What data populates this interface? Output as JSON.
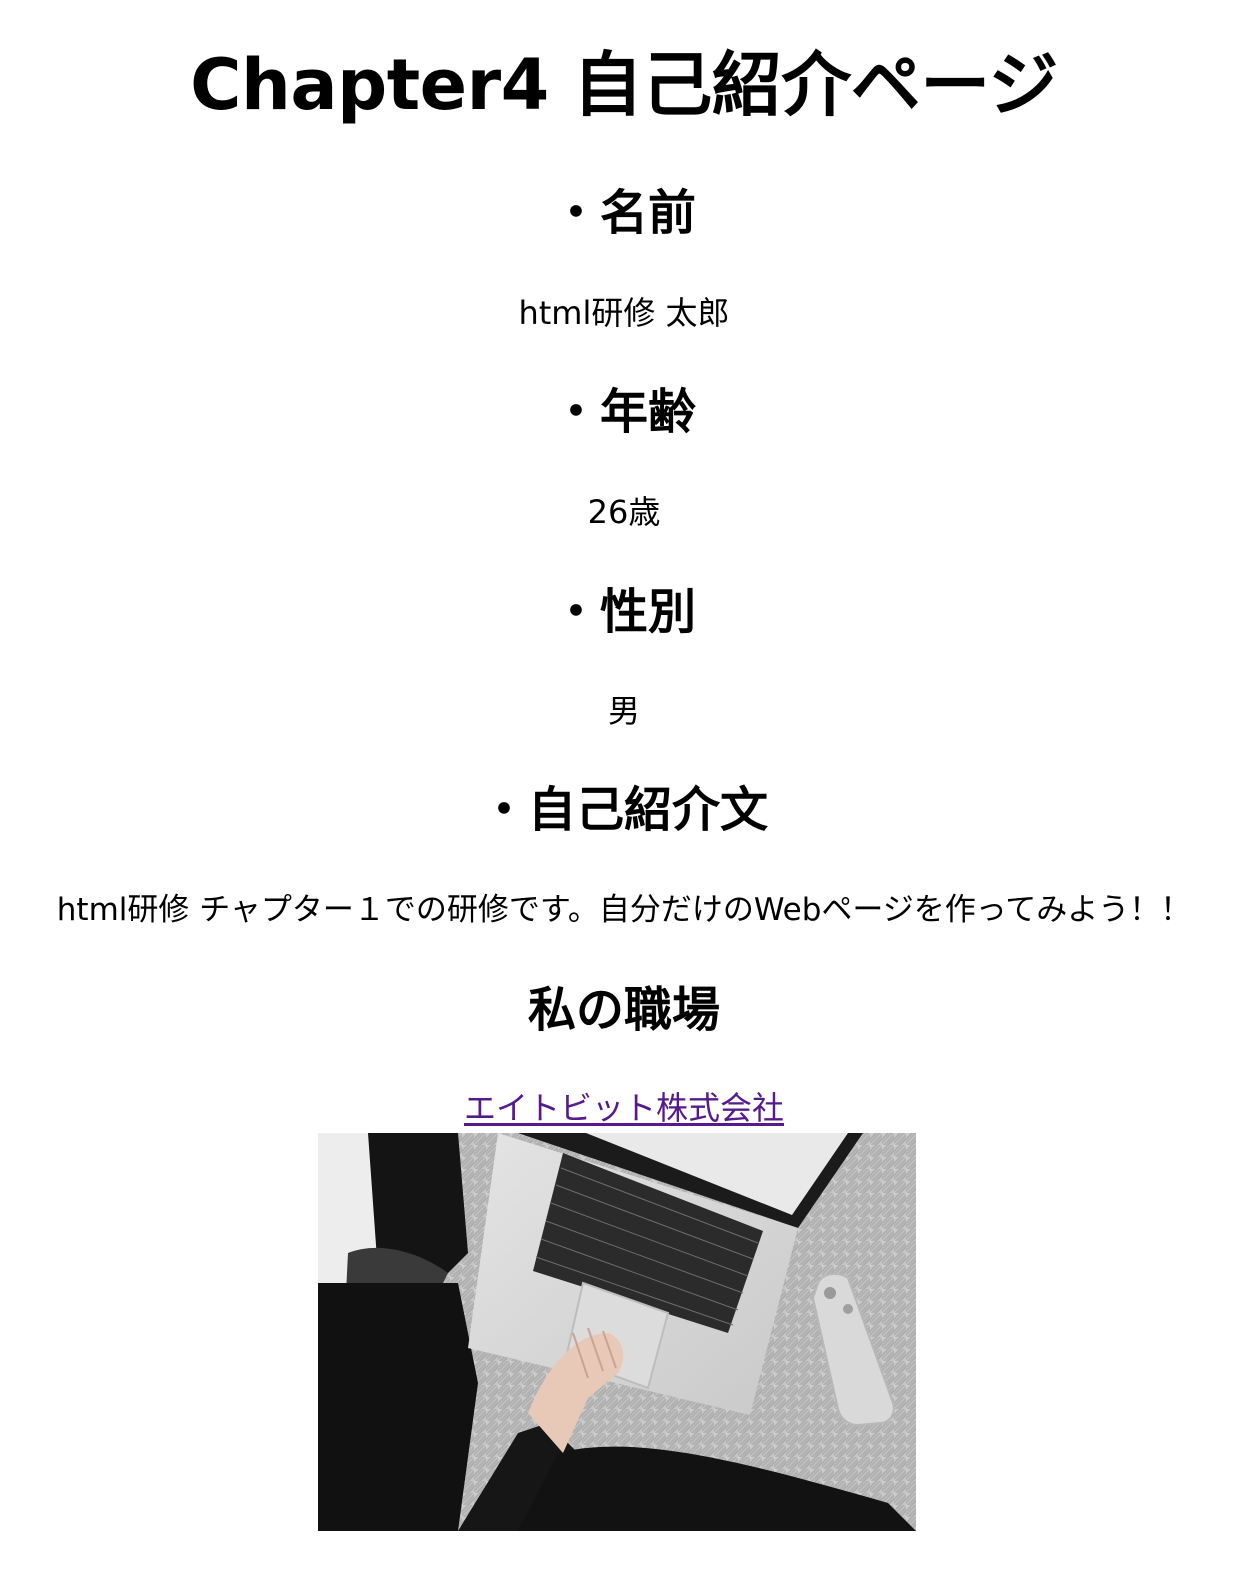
{
  "page_title": "Chapter4 自己紹介ページ",
  "sections": {
    "name": {
      "heading": "・名前",
      "value": "html研修 太郎"
    },
    "age": {
      "heading": "・年齢",
      "value": "26歳"
    },
    "gender": {
      "heading": "・性別",
      "value": "男"
    },
    "intro": {
      "heading": "・自己紹介文",
      "value": "html研修 チャプター１での研修です。自分だけのWebページを作ってみよう！！"
    }
  },
  "workplace": {
    "heading": "私の職場",
    "link_text": "エイトビット株式会社"
  },
  "photo": {
    "icon": "laptop-workspace-photo"
  },
  "colors": {
    "link": "#551a8b",
    "text": "#000000",
    "background": "#ffffff"
  }
}
